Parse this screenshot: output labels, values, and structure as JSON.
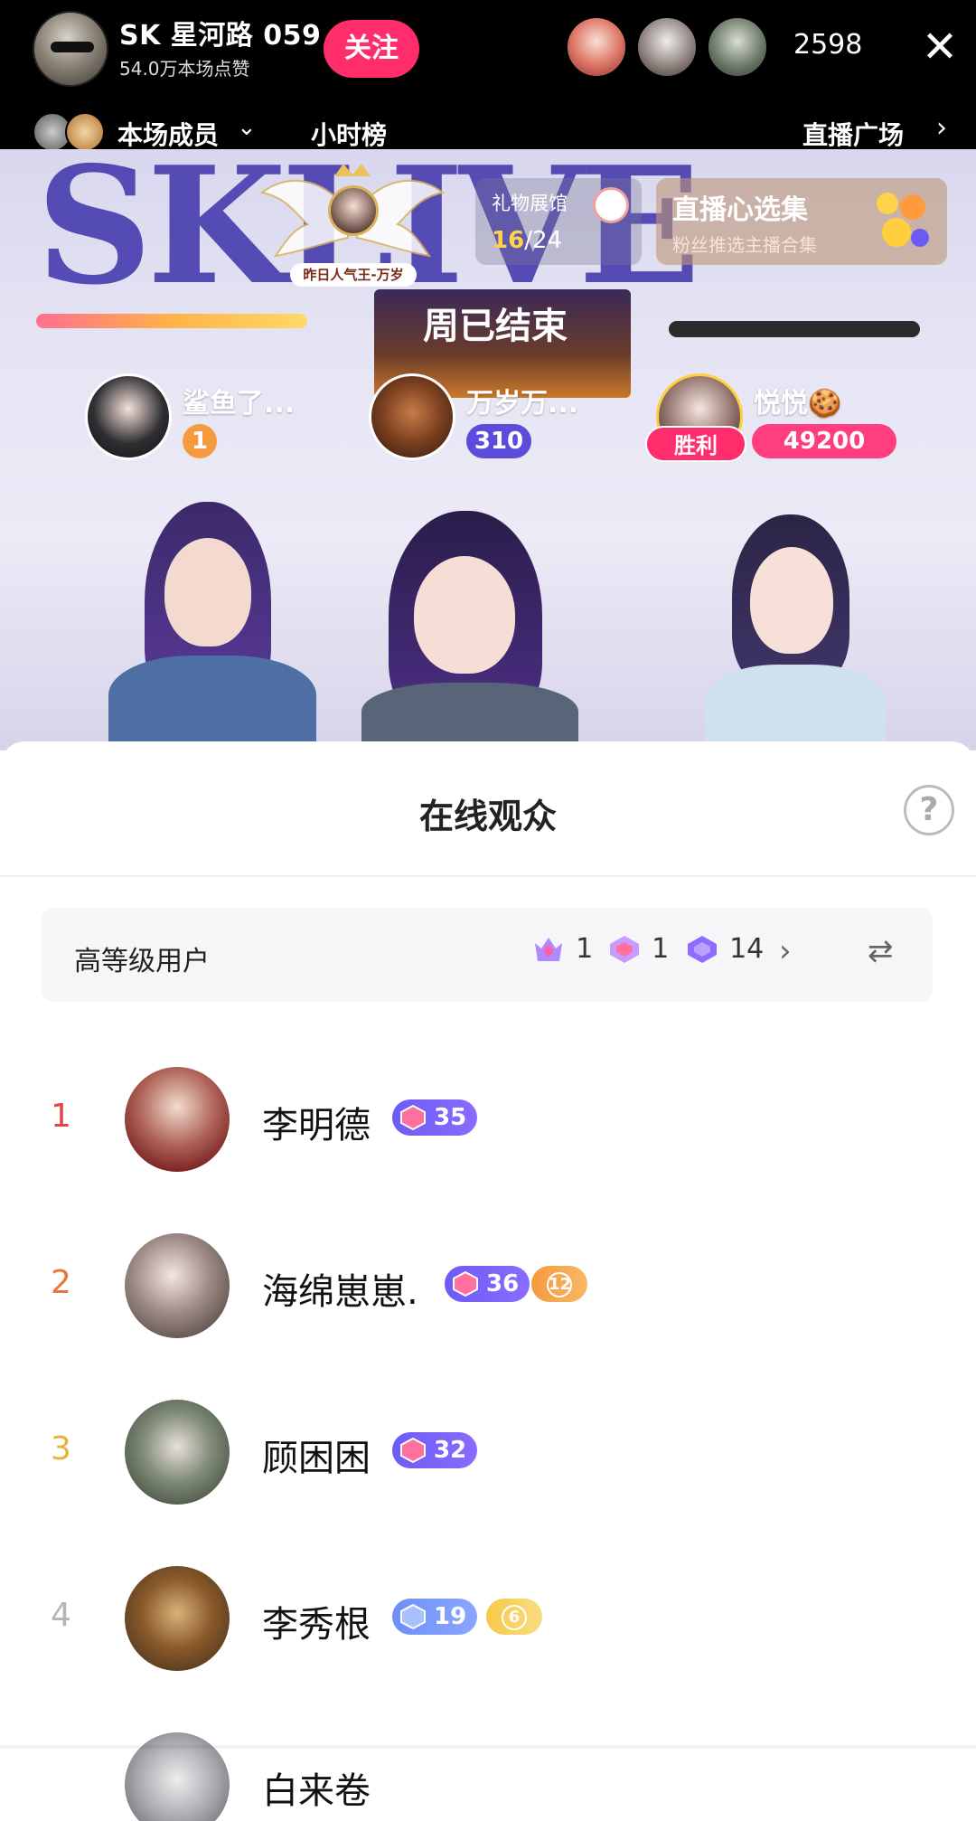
{
  "header": {
    "host_name": "SK 星河路 059",
    "host_likes": "54.0万本场点赞",
    "follow_label": "关注",
    "viewer_count": "2598",
    "close_icon": "✕"
  },
  "members_bar": {
    "members_label": "本场成员",
    "hourly_label": "小时榜",
    "plaza_label": "直播广场"
  },
  "stage": {
    "logo_text": "SKLIVE",
    "emblem_caption": "昨日人气王-万岁",
    "gift_hall": {
      "title": "礼物展馆",
      "progress": "16",
      "total": "/24"
    },
    "pick": {
      "title": "直播心选集",
      "subtitle": "粉丝推选主播合集"
    },
    "week_banner": "周已结束",
    "seats": [
      {
        "name": "鲨鱼了...",
        "badge": "1"
      },
      {
        "name": "万岁万...",
        "badge": "310"
      },
      {
        "name": "悦悦🍪",
        "badge": "49200",
        "win_label": "胜利"
      }
    ]
  },
  "sheet": {
    "title": "在线观众",
    "help_icon": "?",
    "tier": {
      "label": "高等级用户",
      "stats": [
        {
          "icon": "crown-gem-icon",
          "count": "1"
        },
        {
          "icon": "pink-gem-icon",
          "count": "1"
        },
        {
          "icon": "purple-gem-icon",
          "count": "14"
        }
      ]
    },
    "viewers": [
      {
        "rank": "1",
        "name": "李明德",
        "level": "35",
        "fan_level": ""
      },
      {
        "rank": "2",
        "name": "海绵崽崽.",
        "level": "36",
        "fan_level": "12"
      },
      {
        "rank": "3",
        "name": "顾困困",
        "level": "32",
        "fan_level": ""
      },
      {
        "rank": "4",
        "name": "李秀根",
        "level": "19",
        "fan_level": "6"
      },
      {
        "rank": "",
        "name": "白来卷",
        "level": "",
        "fan_level": ""
      }
    ]
  },
  "colors": {
    "accent_pink": "#ff2d6b",
    "level_purple": "#6b5bf5",
    "rank1": "#e04848",
    "rank2": "#e8773a",
    "rank3": "#e6b23a",
    "rank4": "#b5b5b5"
  }
}
